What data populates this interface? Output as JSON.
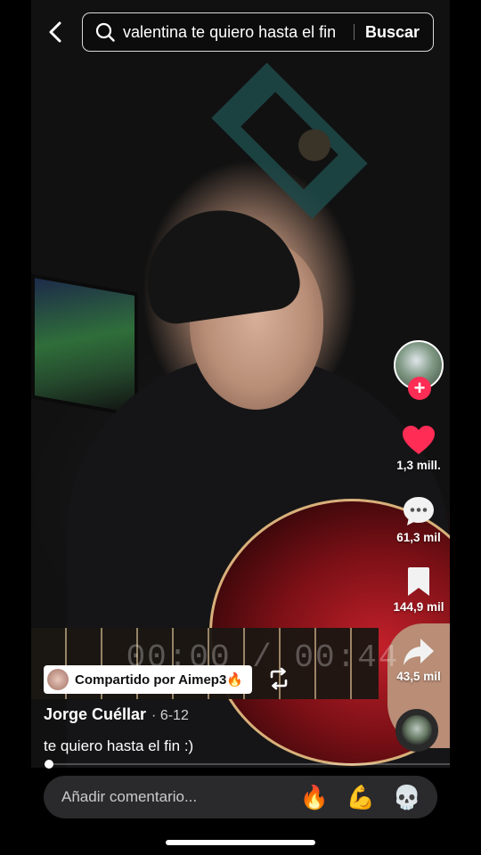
{
  "search": {
    "query": "valentina te quiero hasta el fin",
    "button_label": "Buscar"
  },
  "video": {
    "timecode": "00:00 / 00:44",
    "progress_fraction": 0.01
  },
  "actions": {
    "likes": "1,3 mill.",
    "comments": "61,3 mil",
    "saves": "144,9 mil",
    "shares": "43,5 mil"
  },
  "post": {
    "shared_by": "Compartido por Aimep3🔥",
    "author": "Jorge Cuéllar",
    "date": "· 6-12",
    "caption": "te quiero hasta el fin :)"
  },
  "comment_bar": {
    "placeholder": "Añadir comentario...",
    "emojis": [
      "🔥",
      "💪",
      "💀"
    ]
  },
  "colors": {
    "like": "#ff2c55",
    "follow": "#ff2c55"
  },
  "icons": [
    "back-icon",
    "search-icon",
    "heart-icon",
    "comment-icon",
    "bookmark-icon",
    "share-icon",
    "repost-icon",
    "plus-icon"
  ]
}
